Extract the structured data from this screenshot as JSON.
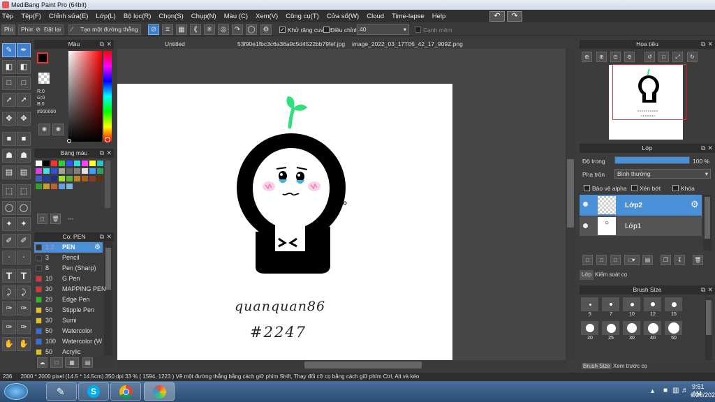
{
  "title": "MediBang Paint Pro (64bit)",
  "menu": [
    "Tệp",
    "Tệp(F)",
    "Chỉnh sửa(E)",
    "Lớp(L)",
    "Bộ lọc(R)",
    "Chọn(S)",
    "Chụp(N)",
    "Màu (C)",
    "Xem(V)",
    "Công cụ(T)",
    "Cửa sổ(W)",
    "Cloud",
    "Time-lapse",
    "Help"
  ],
  "options": {
    "tab1": "Phi",
    "tab2": "Phim",
    "reset": "Đặt lại",
    "make_line": "Tạo một đường thẳng",
    "antialias": "Khử răng cưa",
    "adjust": "Điều chỉnh",
    "adjust_value": "40",
    "edge_soft": "Cạnh mềm"
  },
  "color_panel": {
    "title": "Màu",
    "r": "R:0",
    "g": "G:0",
    "b": "B:0",
    "hex": "#000000"
  },
  "palette_panel": {
    "title": "Bảng màu",
    "dash": "---"
  },
  "brush_panel": {
    "title": "Cọ: PEN",
    "items": [
      {
        "size": "1.2",
        "name": "PEN",
        "color": "#333333"
      },
      {
        "size": "3",
        "name": "Pencil",
        "color": "#333333"
      },
      {
        "size": "8",
        "name": "Pen (Sharp)",
        "color": "#333333"
      },
      {
        "size": "10",
        "name": "G Pen",
        "color": "#e03030"
      },
      {
        "size": "30",
        "name": "MAPPING PEN",
        "color": "#e03030"
      },
      {
        "size": "20",
        "name": "Edge Pen",
        "color": "#20c020"
      },
      {
        "size": "50",
        "name": "Stipple Pen",
        "color": "#e0c020"
      },
      {
        "size": "30",
        "name": "Sumi",
        "color": "#e0c020"
      },
      {
        "size": "50",
        "name": "Watercolor",
        "color": "#3070e0"
      },
      {
        "size": "100",
        "name": "Watercolor (W",
        "color": "#3070e0"
      },
      {
        "size": "50",
        "name": "Acrylic",
        "color": "#e0c020"
      }
    ]
  },
  "doc_tabs": [
    "Untitled",
    "53f90e1fbc3c6a36a9c5d4522bb79fef.jpg",
    "image_2022_03_17T06_42_17_909Z.png"
  ],
  "drawing_text": {
    "line1": "quanquan86",
    "line2": "#2247"
  },
  "navigator": {
    "title": "Hoa tiêu"
  },
  "layers": {
    "title": "Lớp",
    "opacity_label": "Độ trong",
    "opacity_value": "100 %",
    "opacity_fraction": 1.0,
    "blend_label": "Pha trộn",
    "blend_value": "Bình thường",
    "protect_alpha": "Bảo vệ alpha",
    "clipping": "Xén bớt",
    "lock": "Khóa",
    "items": [
      {
        "name": "Lớp2",
        "selected": true
      },
      {
        "name": "Lớp1",
        "selected": false
      }
    ],
    "tab_layer": "Lớp",
    "tab_control": "Kiểm soát cọ"
  },
  "brush_size": {
    "title": "Brush Size",
    "row1": [
      "5",
      "7",
      "10",
      "12",
      "15"
    ],
    "row2": [
      "20",
      "25",
      "30",
      "40",
      "50"
    ],
    "tab_size": "Brush Size",
    "tab_preview": "Xem trước cọ"
  },
  "status": {
    "zoom_value": "236",
    "text": "2000 * 2000 pixel   (14.5 * 14.5cm)   350 dpi   33 %   ( 1594, 1223 )   Vẽ một đường thẳng bằng cách giữ phím Shift, Thay đổi cỡ cọ bằng cách giữ phím Ctrl, Alt và kéo"
  },
  "taskbar": {
    "time": "9:51 AM",
    "date": "6/26/202"
  },
  "colors": {
    "accent": "#4a90d9",
    "sprout": "#2ee07a",
    "blush": "#f27ab8",
    "tears": "#3ab4e0"
  },
  "icons": [
    "brush-icon",
    "eraser-icon",
    "bucket-icon",
    "lasso-icon",
    "wand-icon",
    "text-icon",
    "hand-icon",
    "eyedropper-icon",
    "undo-icon",
    "redo-icon",
    "gear-icon",
    "trash-icon"
  ]
}
